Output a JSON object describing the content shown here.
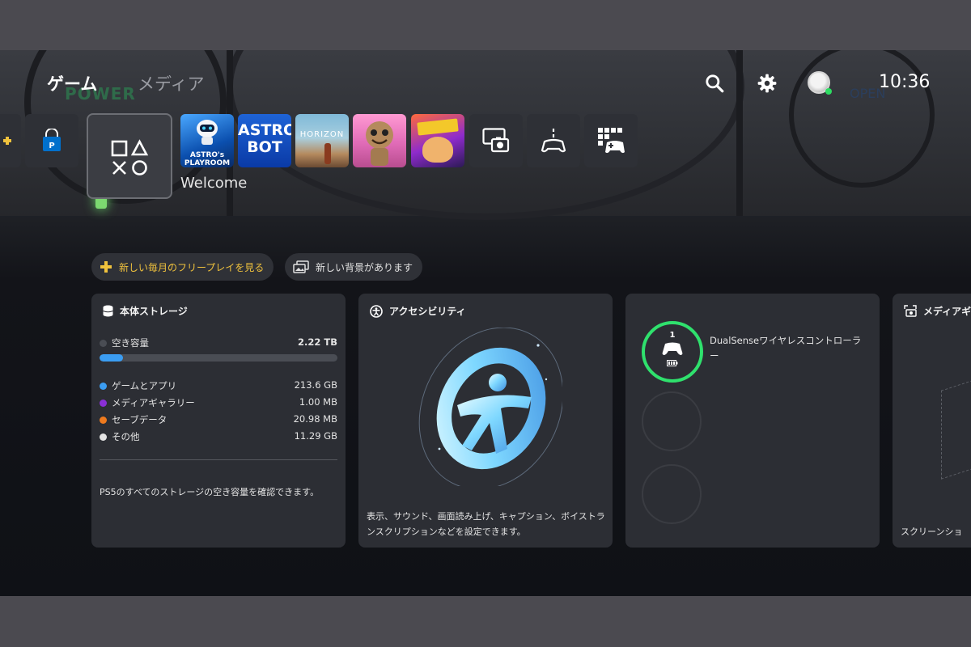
{
  "header": {
    "tabs": [
      {
        "label": "ゲーム",
        "active": true
      },
      {
        "label": "メディア",
        "active": false
      }
    ],
    "clock": "10:36",
    "icons": [
      "search-icon",
      "gear-icon",
      "avatar"
    ]
  },
  "background_art": {
    "power_label": "POWER",
    "open_label": "OPEN"
  },
  "tiles": [
    {
      "name": "partial-tile",
      "icon": "plus-icon"
    },
    {
      "name": "playstation-store-tile",
      "icon": "ps-store-icon"
    },
    {
      "name": "game-library-tile",
      "icon": "ps-symbols-icon",
      "selected": true
    },
    {
      "name": "astros-playroom-tile",
      "art_text": "ASTRO's PLAYROOM"
    },
    {
      "name": "astro-bot-tile",
      "art_text": "ASTRO BOT"
    },
    {
      "name": "horizon-tile",
      "art_text": "HORIZON"
    },
    {
      "name": "sackboy-tile",
      "art_text": ""
    },
    {
      "name": "ratchet-clank-tile",
      "art_text": ""
    },
    {
      "name": "remote-play-tile",
      "icon": "screen-camera-icon"
    },
    {
      "name": "accessories-tile",
      "icon": "controller-wave-icon"
    },
    {
      "name": "game-base-tile",
      "icon": "grid-controller-icon"
    }
  ],
  "selected_label": "Welcome",
  "chips": {
    "plus": "新しい毎月のフリープレイを見る",
    "background": "新しい背景があります"
  },
  "cards": {
    "storage": {
      "title": "本体ストレージ",
      "free_label": "空き容量",
      "free_value": "2.22 TB",
      "used_fraction": 0.1,
      "rows": [
        {
          "label": "ゲームとアプリ",
          "value": "213.6 GB",
          "color": "#3b9df2"
        },
        {
          "label": "メディアギャラリー",
          "value": "1.00 MB",
          "color": "#8a2fd6"
        },
        {
          "label": "セーブデータ",
          "value": "20.98 MB",
          "color": "#ee7a1e"
        },
        {
          "label": "その他",
          "value": "11.29 GB",
          "color": "#e4e4e4"
        }
      ],
      "description": "PS5のすべてのストレージの空き容量を確認できます。"
    },
    "accessibility": {
      "title": "アクセシビリティ",
      "description": "表示、サウンド、画面読み上げ、キャプション、ボイストランスクリプションなどを設定できます。"
    },
    "controller": {
      "slot_number": "1",
      "name": "DualSenseワイヤレスコントローラー"
    },
    "media": {
      "title": "メディアギャ",
      "description": "スクリーンショ"
    }
  },
  "colors": {
    "accent_green": "#2fe16d",
    "plus_gold": "#f0c23d",
    "card_bg": "#2c2e34"
  }
}
